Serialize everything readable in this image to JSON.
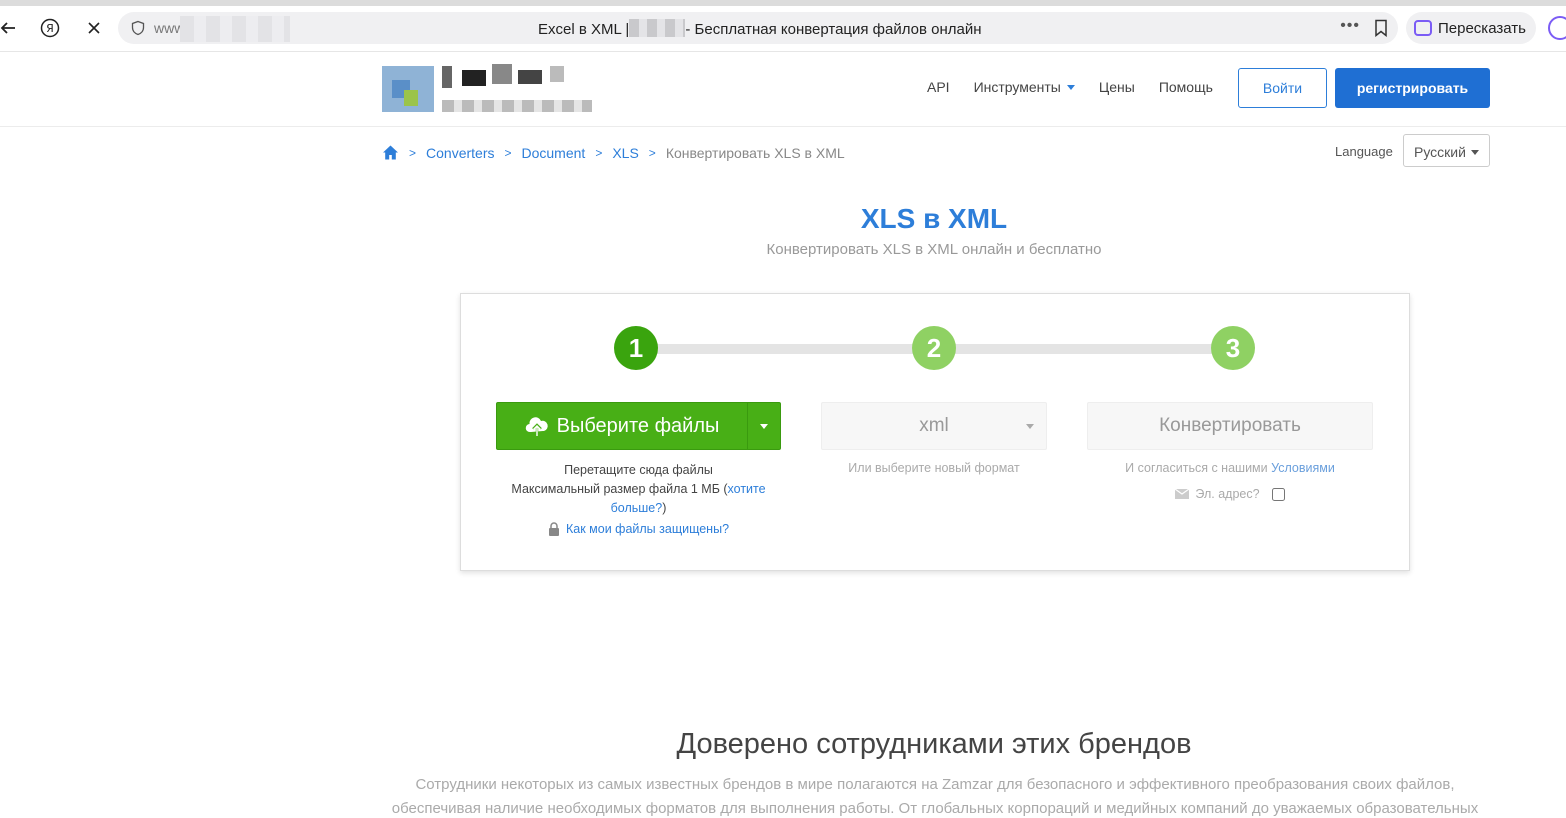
{
  "browser": {
    "url_prefix": "www",
    "tab_title_left": "Excel в XML |",
    "tab_title_right": "- Бесплатная конвертация файлов онлайн",
    "retell_label": "Пересказать"
  },
  "header": {
    "nav": {
      "api": "API",
      "tools": "Инструменты",
      "prices": "Цены",
      "help": "Помощь"
    },
    "login_label": "Войти",
    "register_label": "регистрировать"
  },
  "breadcrumb": {
    "items": [
      "Converters",
      "Document",
      "XLS"
    ],
    "current": "Конвертировать XLS в XML",
    "separator": ">"
  },
  "language": {
    "label": "Language",
    "selected": "Русский"
  },
  "hero": {
    "title": "XLS в XML",
    "subtitle": "Конвертировать XLS в XML онлайн и бесплатно"
  },
  "converter": {
    "steps": [
      "1",
      "2",
      "3"
    ],
    "choose_files_label": "Выберите файлы",
    "drop_hint": "Перетащите сюда файлы",
    "max_size_prefix": "Максимальный размер файла 1 МБ (",
    "max_size_link": "хотите больше?",
    "max_size_suffix": ")",
    "secure_link": "Как мои файлы защищены?",
    "format_value": "xml",
    "format_hint": "Или выберите новый формат",
    "convert_label": "Конвертировать",
    "terms_prefix": "И согласиться с нашими ",
    "terms_link": "Условиями",
    "email_label": "Эл. адрес?"
  },
  "trusted": {
    "title": "Доверено сотрудниками этих брендов",
    "text": "Сотрудники некоторых из самых известных брендов в мире полагаются на Zamzar для безопасного и эффективного преобразования своих файлов, обеспечивая наличие необходимых форматов для выполнения работы. От глобальных корпораций и медийных компаний до уважаемых образовательных"
  },
  "colors": {
    "accent_blue": "#2d7ed9",
    "register_blue": "#1f6fd3",
    "step_active_green": "#3aa40e",
    "step_inactive_green": "#8fd163",
    "upload_green": "#48af16"
  },
  "icons": {
    "back": "arrow-left-icon",
    "yandex": "yandex-logo-icon",
    "close": "close-icon",
    "shield": "shield-icon",
    "more": "more-dots-icon",
    "bookmark": "bookmark-icon",
    "retell": "retell-icon",
    "alice": "alice-icon",
    "home": "home-icon",
    "upload": "cloud-upload-icon",
    "lock": "lock-icon",
    "mail": "envelope-icon"
  }
}
